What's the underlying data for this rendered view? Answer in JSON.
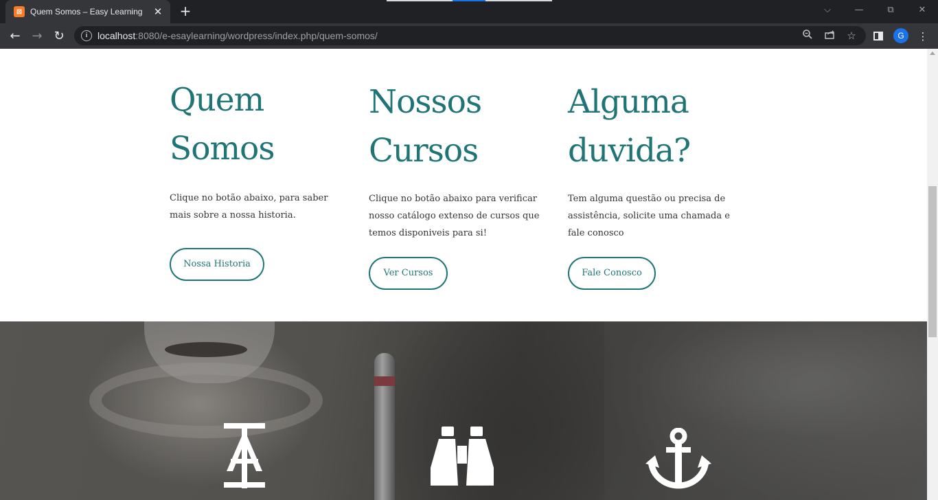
{
  "browser": {
    "tab_title": "Quem Somos – Easy Learning",
    "tab_favicon_letter": "⊠",
    "new_tab_label": "+",
    "url_host": "localhost",
    "url_rest": ":8080/e-esaylearning/wordpress/index.php/quem-somos/",
    "profile_initial": "G",
    "window_controls": {
      "tab_search": "⌵",
      "minimize": "—",
      "restore": "⧉",
      "close": "✕"
    },
    "nav": {
      "back": "←",
      "forward": "→",
      "reload": "↻"
    }
  },
  "columns": [
    {
      "heading_line1": "Quem",
      "heading_line2": "Somos",
      "text": "Clique no botão abaixo, para saber mais sobre a nossa historia.",
      "button": "Nossa Historia"
    },
    {
      "heading_line1": "Nossos",
      "heading_line2": "Cursos",
      "text": "Clique no botão abaixo para verificar nosso catálogo extenso de cursos que temos disponiveis para si!",
      "button": "Ver Cursos"
    },
    {
      "heading_line1": "Alguma",
      "heading_line2": "duvida?",
      "text": "Tem alguma questão ou precisa de assistência, solicite uma chamada e fale conosco",
      "button": "Fale Conosco"
    }
  ],
  "hero_icons": [
    "type-icon",
    "binoculars-icon",
    "anchor-icon"
  ],
  "colors": {
    "accent": "#1f7575",
    "chrome_dark": "#202124",
    "chrome_mid": "#35363a"
  }
}
